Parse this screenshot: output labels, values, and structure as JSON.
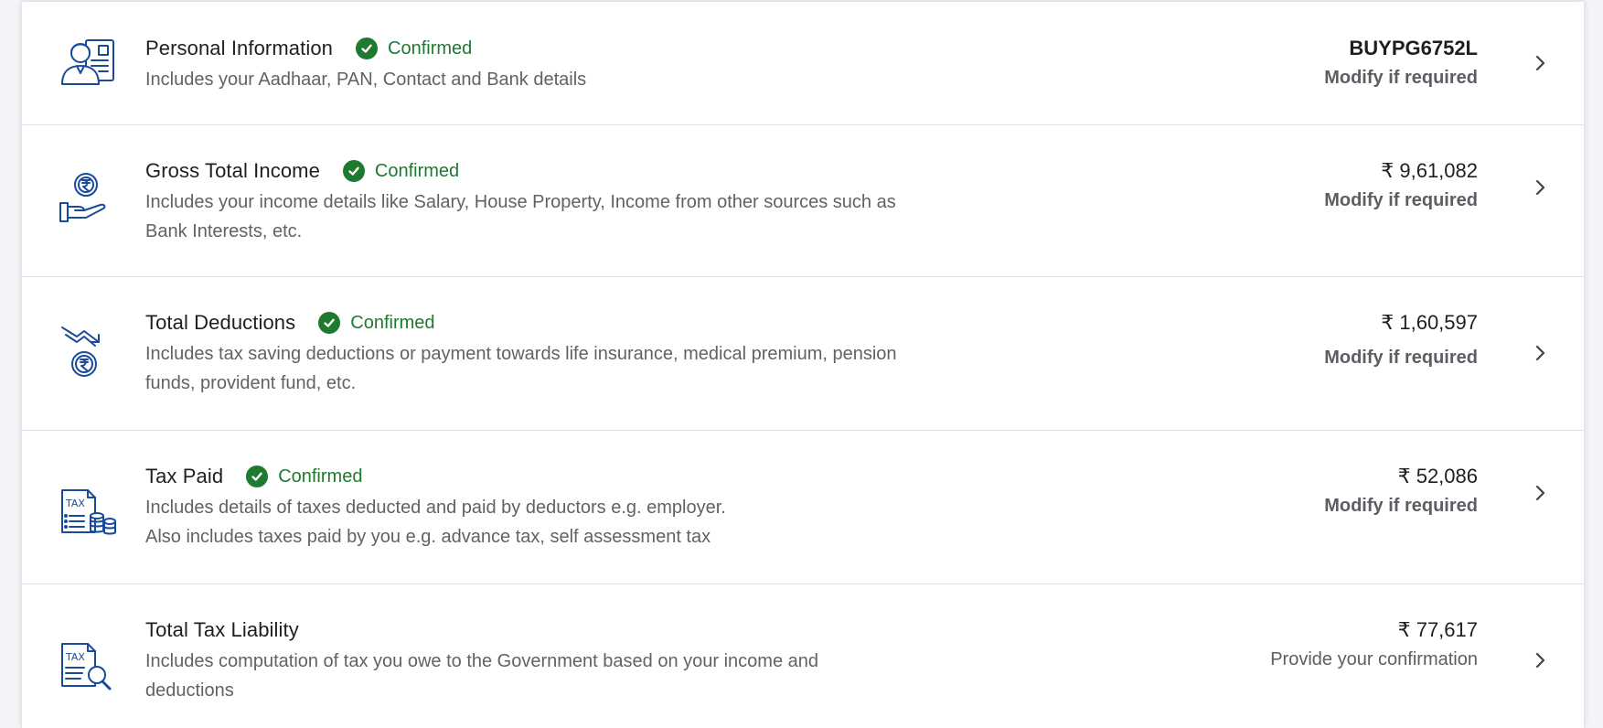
{
  "rows": [
    {
      "title": "Personal Information",
      "status": "Confirmed",
      "description": "Includes your Aadhaar, PAN, Contact and Bank details",
      "value": "BUYPG6752L",
      "action": "Modify if required",
      "icon": "personal-info-icon"
    },
    {
      "title": "Gross Total Income",
      "status": "Confirmed",
      "description": "Includes your income details like Salary, House Property, Income from other sources such as Bank Interests, etc.",
      "value": "₹ 9,61,082",
      "action": "Modify if required",
      "icon": "income-hand-rupee-icon"
    },
    {
      "title": "Total Deductions",
      "status": "Confirmed",
      "description": "Includes tax saving deductions or payment towards life insurance, medical premium, pension funds, provident fund, etc.",
      "value": "₹ 1,60,597",
      "action": "Modify if required",
      "icon": "deduction-trend-rupee-icon"
    },
    {
      "title": "Tax Paid",
      "status": "Confirmed",
      "description_line1": "Includes details of taxes deducted and paid by deductors e.g. employer.",
      "description_line2": "Also includes taxes paid by you e.g. advance tax, self assessment tax",
      "value": "₹ 52,086",
      "action": "Modify if required",
      "icon": "tax-document-coins-icon"
    },
    {
      "title": "Total Tax Liability",
      "description": "Includes computation of tax you owe to the Government based on your income and deductions",
      "value": "₹ 77,617",
      "action": "Provide your confirmation",
      "icon": "tax-document-search-icon"
    }
  ],
  "colors": {
    "confirmed_green": "#1e7a2e",
    "icon_blue": "#1a4a9a",
    "text_dark": "#1f1f1f",
    "text_muted": "#5f6266"
  }
}
